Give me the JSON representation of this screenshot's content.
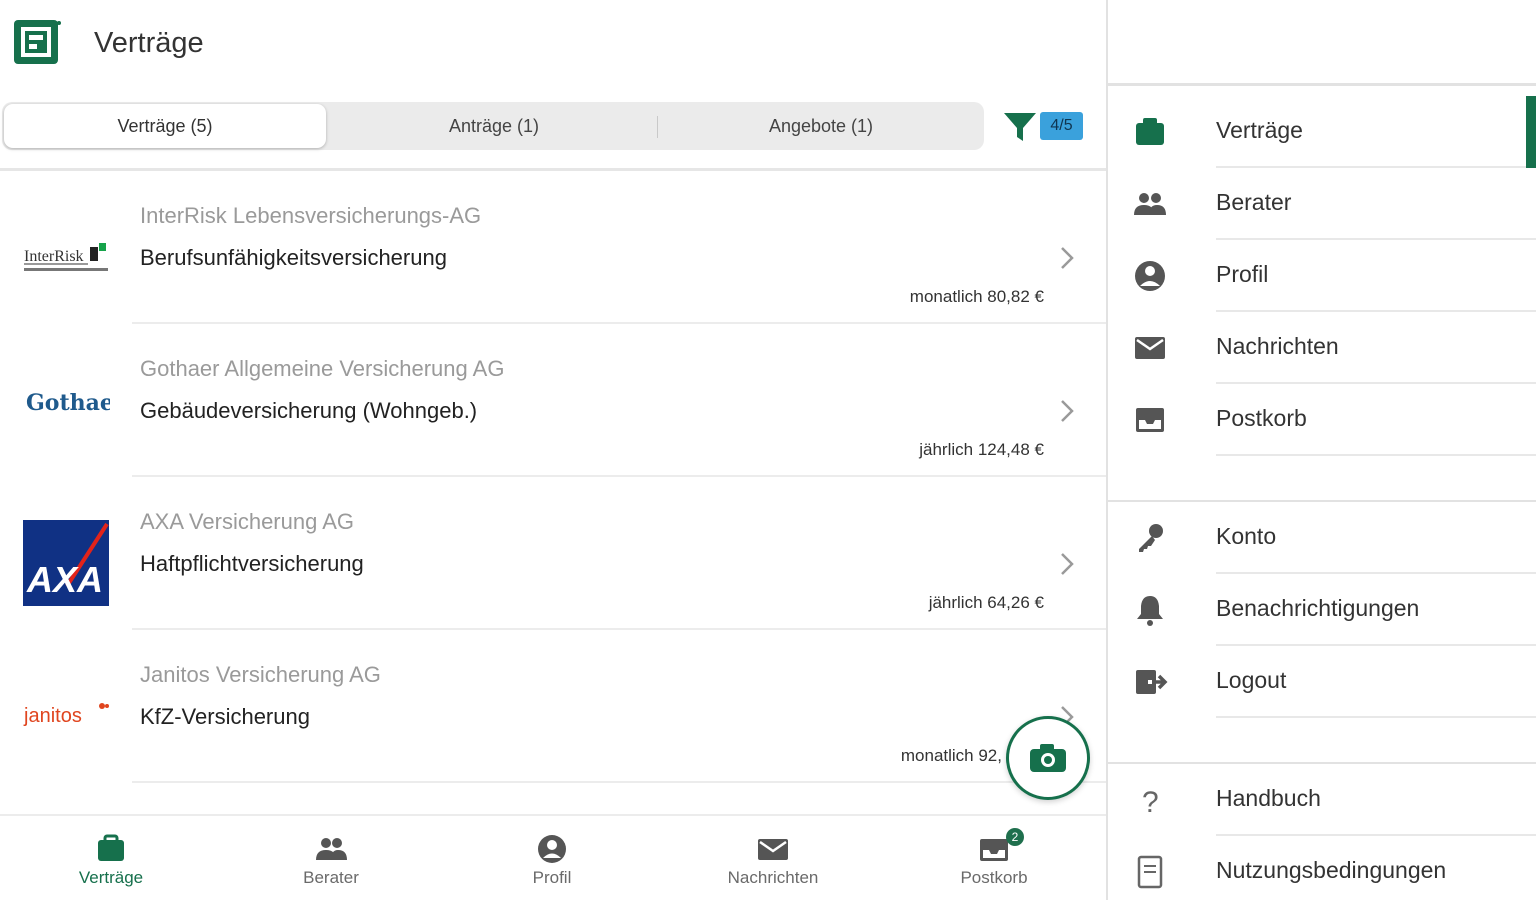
{
  "app": {
    "title": "Verträge"
  },
  "colors": {
    "brand": "#16704c",
    "badge_blue": "#3aa1dc",
    "muted_text": "#9a9a9a"
  },
  "tabs": [
    {
      "label": "Verträge (5)",
      "active": true
    },
    {
      "label": "Anträge (1)",
      "active": false
    },
    {
      "label": "Angebote (1)",
      "active": false
    }
  ],
  "filter": {
    "icon": "filter-icon",
    "badge": "4/5"
  },
  "contracts": [
    {
      "insurer": "InterRisk Lebensversicherungs-AG",
      "product": "Berufsunfähigkeitsversicherung",
      "price": "monatlich 80,82 €",
      "logo_text": "InterRisk",
      "logo": "interrisk-logo"
    },
    {
      "insurer": "Gothaer Allgemeine Versicherung AG",
      "product": "Gebäudeversicherung (Wohngeb.)",
      "price": "jährlich 124,48 €",
      "logo_text": "Gothaer",
      "logo": "gothaer-logo"
    },
    {
      "insurer": "AXA Versicherung AG",
      "product": "Haftpflichtversicherung",
      "price": "jährlich 64,26 €",
      "logo_text": "AXA",
      "logo": "axa-logo"
    },
    {
      "insurer": "Janitos Versicherung AG",
      "product": "KfZ-Versicherung",
      "price": "monatlich 92,",
      "logo_text": "janitos",
      "logo": "janitos-logo"
    }
  ],
  "camera": {
    "icon": "camera-icon"
  },
  "bottom_nav": [
    {
      "label": "Verträge",
      "icon": "briefcase-icon",
      "active": true
    },
    {
      "label": "Berater",
      "icon": "people-icon",
      "active": false
    },
    {
      "label": "Profil",
      "icon": "account-circle-icon",
      "active": false
    },
    {
      "label": "Nachrichten",
      "icon": "envelope-icon",
      "active": false
    },
    {
      "label": "Postkorb",
      "icon": "inbox-icon",
      "active": false,
      "badge": "2"
    }
  ],
  "drawer": {
    "main": [
      {
        "label": "Verträge",
        "icon": "briefcase-icon",
        "active": true
      },
      {
        "label": "Berater",
        "icon": "people-icon"
      },
      {
        "label": "Profil",
        "icon": "account-circle-icon"
      },
      {
        "label": "Nachrichten",
        "icon": "envelope-icon"
      },
      {
        "label": "Postkorb",
        "icon": "inbox-icon"
      }
    ],
    "account": [
      {
        "label": "Konto",
        "icon": "key-icon"
      },
      {
        "label": "Benachrichtigungen",
        "icon": "bell-icon"
      },
      {
        "label": "Logout",
        "icon": "logout-icon"
      }
    ],
    "help": [
      {
        "label": "Handbuch",
        "icon": "help-icon"
      },
      {
        "label": "Nutzungsbedingungen",
        "icon": "document-icon"
      }
    ]
  }
}
